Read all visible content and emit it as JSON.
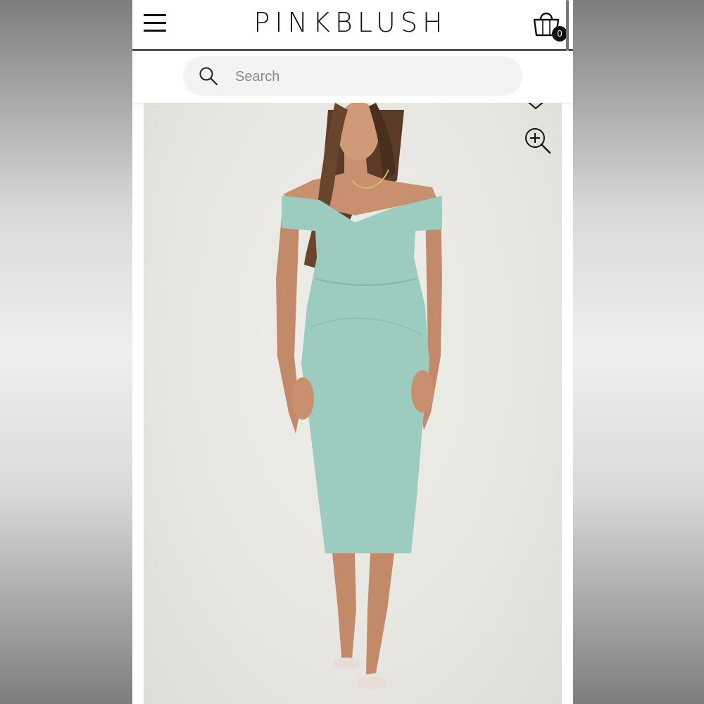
{
  "header": {
    "brand": "PINKBLUSH",
    "menu_icon": "hamburger-menu-icon",
    "cart_icon": "shopping-bag-icon",
    "cart_count": "0"
  },
  "search": {
    "placeholder": "Search",
    "icon": "search-icon"
  },
  "product": {
    "image_icons": [
      "heart-icon",
      "zoom-in-icon"
    ],
    "dress_color": "#9ccbc0"
  }
}
